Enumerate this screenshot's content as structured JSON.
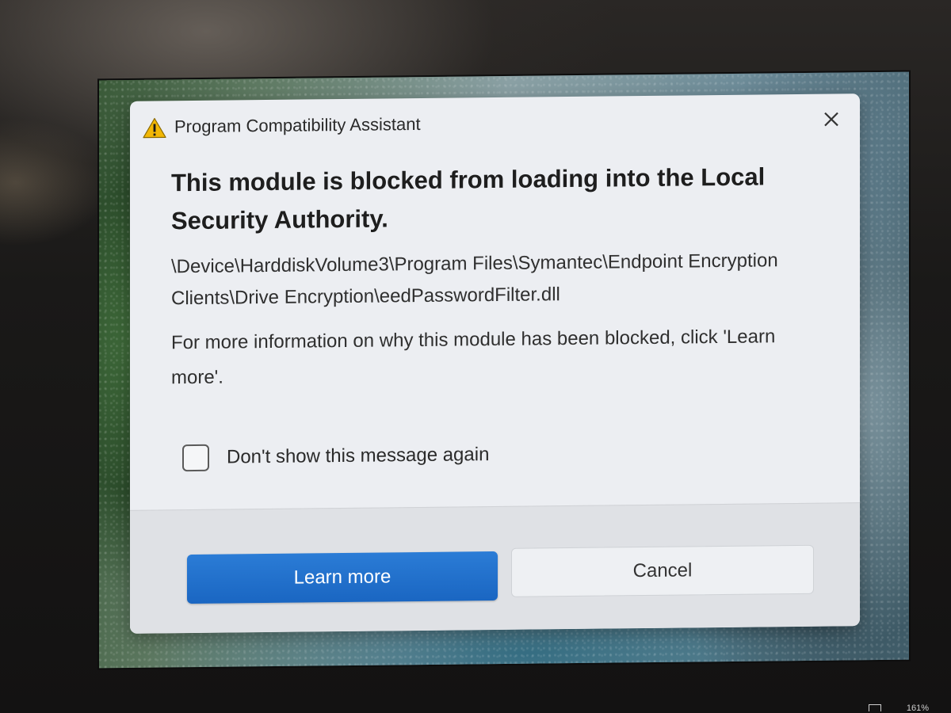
{
  "dialog": {
    "title": "Program Compatibility Assistant",
    "heading": "This module is blocked from loading into the Local Security Authority.",
    "path": "\\Device\\HarddiskVolume3\\Program Files\\Symantec\\Endpoint Encryption Clients\\Drive Encryption\\eedPasswordFilter.dll",
    "info": "For more information on why this module has been blocked, click 'Learn more'.",
    "checkbox_label": "Don't show this message again",
    "checkbox_checked": false,
    "learn_more_label": "Learn more",
    "cancel_label": "Cancel"
  },
  "taskbar": {
    "zoom_level": "161%"
  },
  "colors": {
    "primary_button": "#1a66c2",
    "warning_icon": "#f2b705",
    "dialog_background": "#eceef2"
  },
  "icons": {
    "title": "warning-icon",
    "close": "close-icon"
  }
}
